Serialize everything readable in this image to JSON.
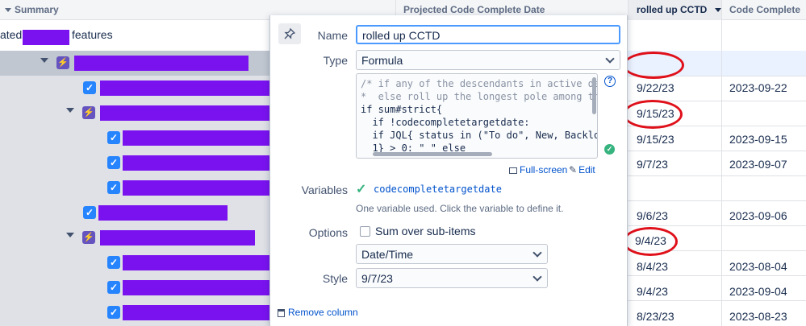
{
  "header": {
    "summary": "Summary",
    "projected": "Projected Code Complete Date",
    "rolled_up": "rolled up CCTD",
    "code_complete": "Code Complete"
  },
  "tree": {
    "top_prefix": "ated",
    "top_suffix": "features"
  },
  "rows": [
    {
      "cctd": "",
      "cc": ""
    },
    {
      "cctd": "9/22/23",
      "cc": "2023-09-22"
    },
    {
      "cctd": "9/15/23",
      "cc": ""
    },
    {
      "cctd": "9/15/23",
      "cc": "2023-09-15"
    },
    {
      "cctd": "9/7/23",
      "cc": "2023-09-07"
    },
    {
      "cctd": "",
      "cc": ""
    },
    {
      "cctd": "9/6/23",
      "cc": "2023-09-06"
    },
    {
      "cctd": "9/4/23",
      "cc": ""
    },
    {
      "cctd": "8/4/23",
      "cc": "2023-08-04"
    },
    {
      "cctd": "9/4/23",
      "cc": "2023-09-04"
    },
    {
      "cctd": "8/23/23",
      "cc": "2023-08-23"
    }
  ],
  "dialog": {
    "name_label": "Name",
    "name_value": "rolled up CCTD",
    "type_label": "Type",
    "type_value": "Formula",
    "code_line1": "/* if any of the descendants in active de",
    "code_line2": "*  else roll up the longest pole among th",
    "code_line3": "if sum#strict{",
    "code_line4": "  if !codecompletetargetdate:",
    "code_line5": "  if JQL{ status in (\"To do\", New, Backlo",
    "code_line6": "  1} > 0: \" \" else",
    "fullscreen": "Full-screen",
    "edit": "Edit",
    "variables_label": "Variables",
    "variable_name": "codecompletetargetdate",
    "variables_hint": "One variable used. Click the variable to define it.",
    "options_label": "Options",
    "option_sum": "Sum over sub-items",
    "format_value": "Date/Time",
    "style_label": "Style",
    "style_value": "9/7/23",
    "remove": "Remove column"
  },
  "colors": {
    "accent": "#0052cc",
    "redaction": "#7a12f0",
    "annotation": "#e0101a",
    "selected_row": "#c1c7d0"
  },
  "icons": {
    "pin": "pin-icon",
    "help": "help-icon",
    "valid": "check-circle-icon",
    "variable_ok": "check-icon",
    "fullscreen": "fullscreen-icon",
    "edit": "pencil-icon",
    "remove": "trash-icon"
  }
}
